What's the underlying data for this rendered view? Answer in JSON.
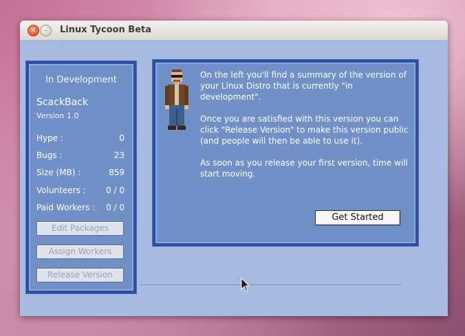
{
  "window": {
    "title": "Linux Tycoon Beta"
  },
  "summary": {
    "status": "In Development",
    "distro_name": "ScackBack",
    "version": "Version 1.0",
    "stats": [
      {
        "label": "Hype :",
        "value": "0"
      },
      {
        "label": "Bugs :",
        "value": "23"
      },
      {
        "label": "Size (MB) :",
        "value": "859"
      },
      {
        "label": "Volunteers :",
        "value": "0 / 0"
      },
      {
        "label": "Paid Workers :",
        "value": "0 / 0"
      }
    ],
    "buttons": {
      "edit_packages": "Edit Packages",
      "assign_workers": "Assign Workers",
      "release_version": "Release Version"
    }
  },
  "intro": {
    "paragraphs": [
      "On the left you'll find a summary of the version of your Linux Distro that is currently \"in development\".",
      "Once you are satisfied with this version you can click \"Release Version\" to make this version public (and people will then be able to use it).",
      "As soon as you release your first version, time will start moving."
    ],
    "get_started_label": "Get Started"
  },
  "icons": {
    "close": "close-icon",
    "minimize": "minimize-icon",
    "character": "character-sprite-icon",
    "cursor": "mouse-cursor-icon"
  },
  "colors": {
    "panel_fill": "#7190c8",
    "panel_border": "#2f4ea0",
    "window_bg": "#a7bbe0"
  }
}
